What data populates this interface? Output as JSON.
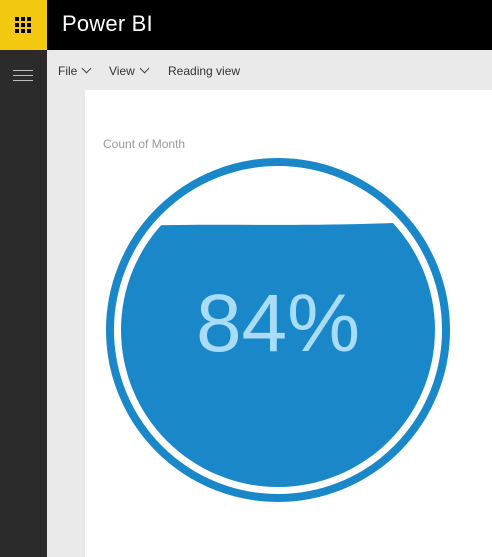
{
  "app": {
    "title": "Power BI"
  },
  "menu": {
    "file_label": "File",
    "view_label": "View",
    "reading_view_label": "Reading view"
  },
  "visual": {
    "title": "Count of Month",
    "value_label": "84%",
    "fill_fraction": 0.84,
    "colors": {
      "fill": "#1a87c9",
      "ring": "#1a87c9",
      "value_text": "#a9dcf6"
    }
  }
}
